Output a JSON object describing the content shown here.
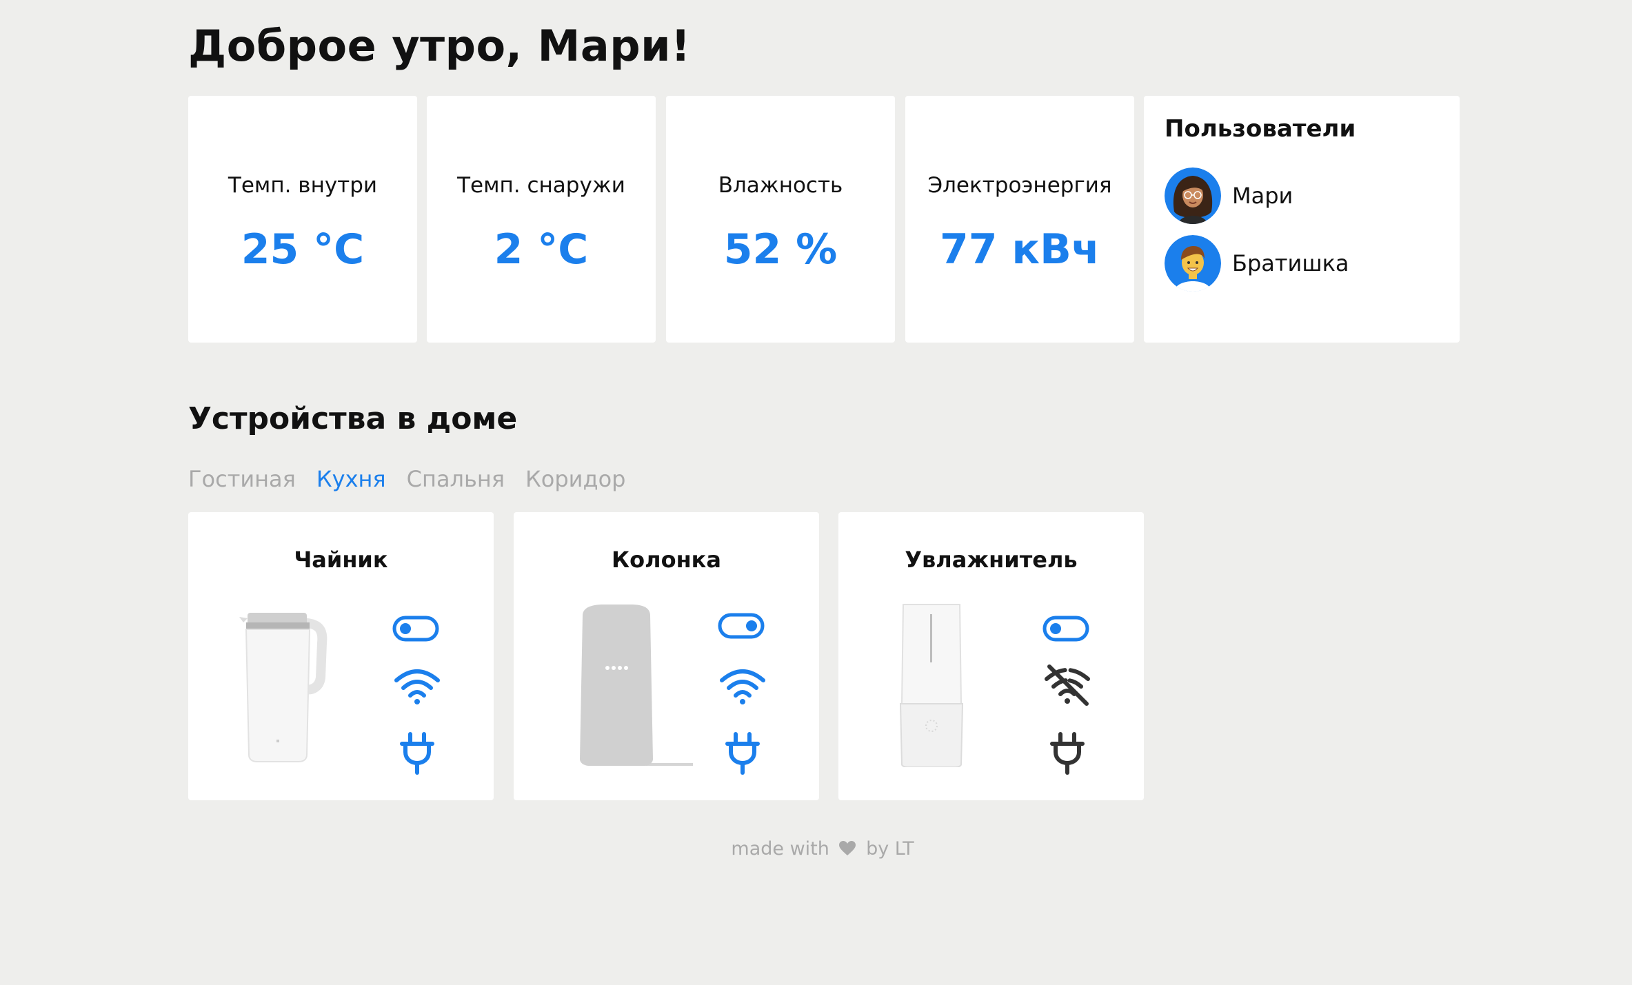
{
  "greeting": "Доброе утро, Мари!",
  "stats": [
    {
      "label": "Темп. внутри",
      "value": "25 °C"
    },
    {
      "label": "Темп. снаружи",
      "value": "2 °C"
    },
    {
      "label": "Влажность",
      "value": "52 %"
    },
    {
      "label": "Электроэнергия",
      "value": "77 кВч"
    }
  ],
  "users": {
    "title": "Пользователи",
    "list": [
      {
        "name": "Мари",
        "avatar": "avatar-woman-icon"
      },
      {
        "name": "Братишка",
        "avatar": "avatar-man-icon"
      }
    ]
  },
  "devices_section": {
    "title": "Устройства в доме",
    "tabs": [
      {
        "label": "Гостиная",
        "active": false
      },
      {
        "label": "Кухня",
        "active": true
      },
      {
        "label": "Спальня",
        "active": false
      },
      {
        "label": "Коридор",
        "active": false
      }
    ],
    "devices": [
      {
        "name": "Чайник",
        "image": "kettle-icon",
        "toggle": "off",
        "wifi": "connected",
        "power": "on"
      },
      {
        "name": "Колонка",
        "image": "smart-speaker-icon",
        "toggle": "on",
        "wifi": "connected",
        "power": "on"
      },
      {
        "name": "Увлажнитель",
        "image": "humidifier-icon",
        "toggle": "off",
        "wifi": "disconnected",
        "power": "off"
      }
    ]
  },
  "footer": {
    "prefix": "made with",
    "suffix": "by LT",
    "icon": "heart-icon"
  },
  "colors": {
    "accent": "#1b7fec",
    "inactive": "#333333",
    "muted": "#a9a9a9",
    "background": "#eeeeec"
  }
}
